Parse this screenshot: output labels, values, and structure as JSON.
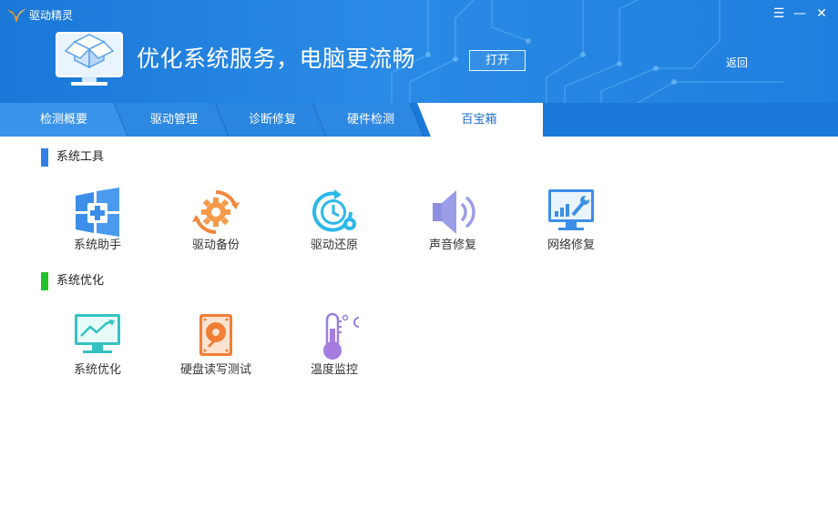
{
  "app": {
    "title": "驱动精灵"
  },
  "window_controls": {
    "menu": "☰",
    "minimize": "—",
    "close": "✕"
  },
  "banner": {
    "text": "优化系统服务，电脑更流畅",
    "open_button": "打开",
    "back_link": "返回"
  },
  "tabs": [
    {
      "label": "检测概要",
      "active": false
    },
    {
      "label": "驱动管理",
      "active": false
    },
    {
      "label": "诊断修复",
      "active": false
    },
    {
      "label": "硬件检测",
      "active": false
    },
    {
      "label": "百宝箱",
      "active": true
    }
  ],
  "sections": [
    {
      "title": "系统工具",
      "accent": "#2f7fe6",
      "tools": [
        {
          "label": "系统助手",
          "icon": "windows-plus-icon"
        },
        {
          "label": "驱动备份",
          "icon": "gear-refresh-icon"
        },
        {
          "label": "驱动还原",
          "icon": "clock-restore-icon"
        },
        {
          "label": "声音修复",
          "icon": "speaker-icon"
        },
        {
          "label": "网络修复",
          "icon": "monitor-wrench-icon"
        }
      ]
    },
    {
      "title": "系统优化",
      "accent": "#22c32a",
      "tools": [
        {
          "label": "系统优化",
          "icon": "monitor-chart-icon"
        },
        {
          "label": "硬盘读写测试",
          "icon": "hard-disk-icon"
        },
        {
          "label": "温度监控",
          "icon": "thermometer-icon"
        }
      ]
    }
  ]
}
